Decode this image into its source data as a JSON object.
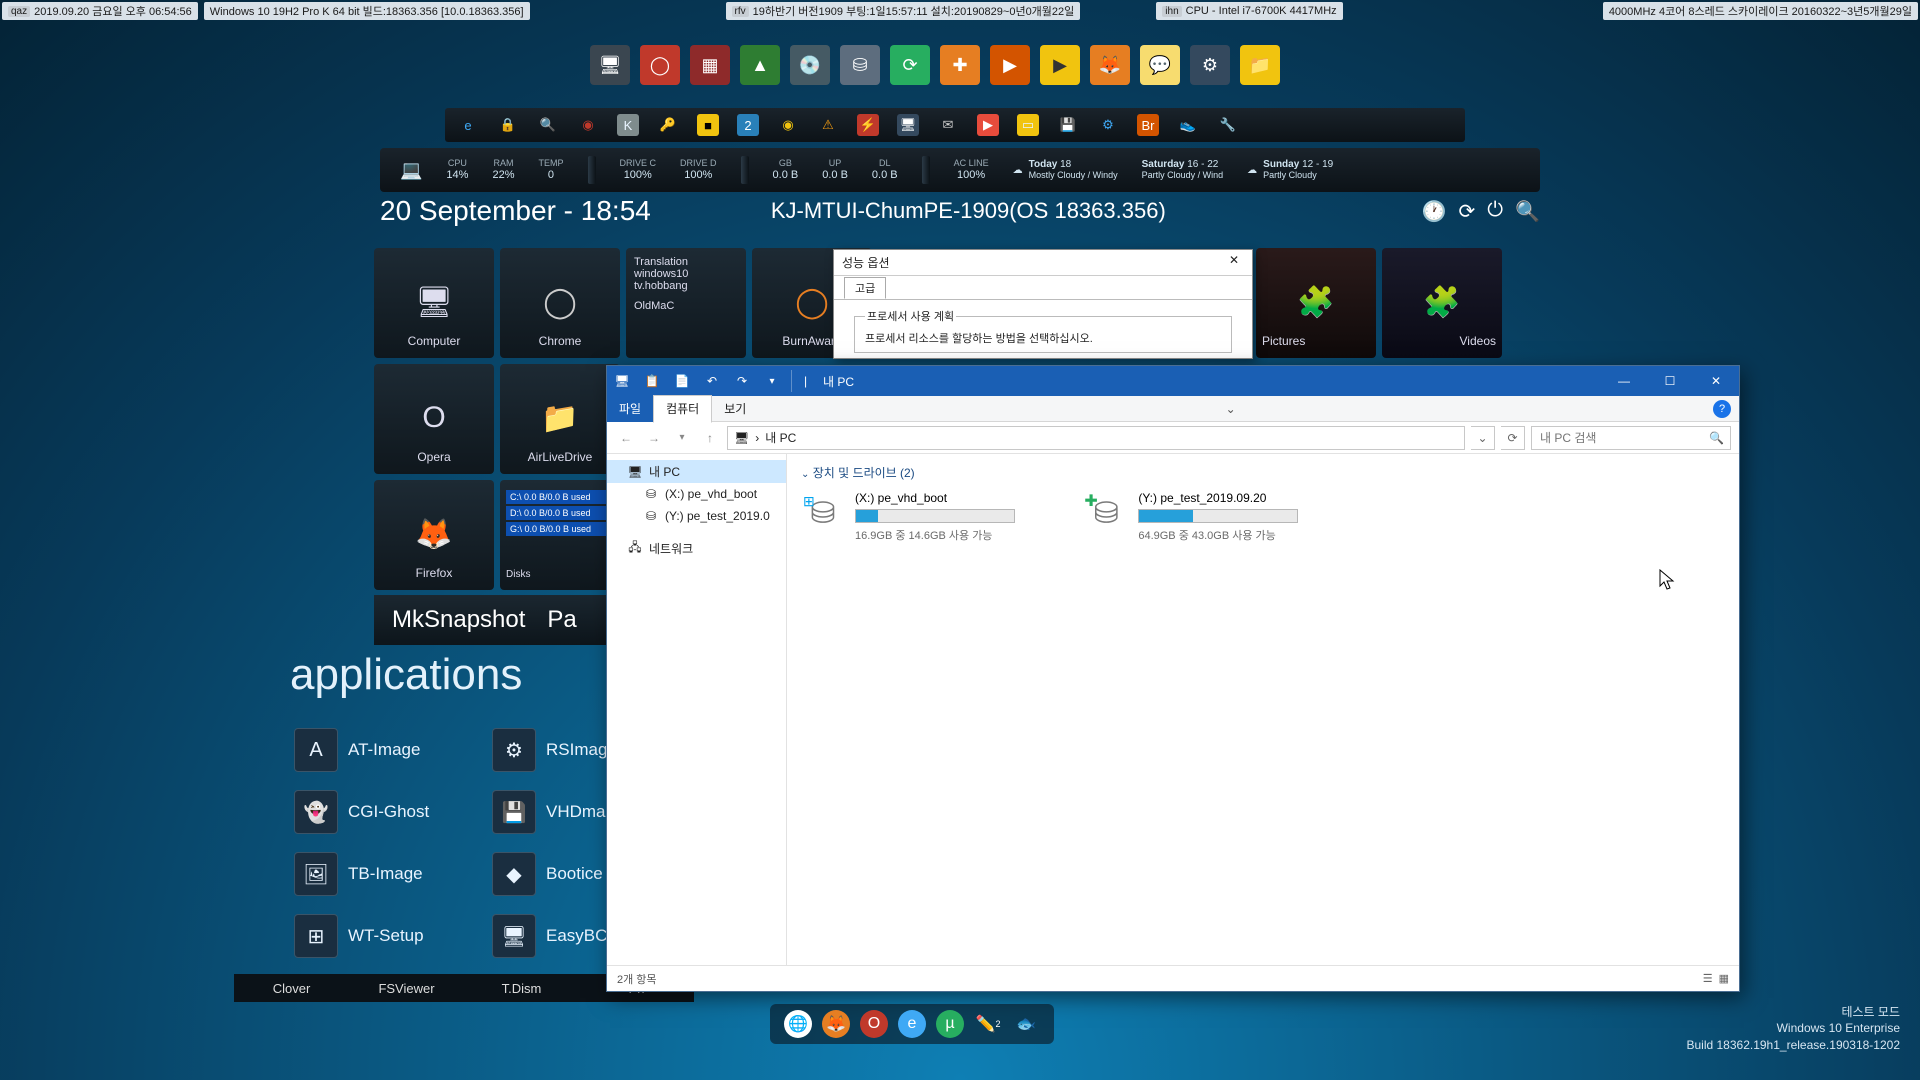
{
  "topInfo": [
    {
      "tag": "qaz",
      "text": "2019.09.20 금요일 오후 06:54:56"
    },
    {
      "tag": "",
      "text": "Windows 10 19H2 Pro K 64 bit 빌드:18363.356 [10.0.18363.356]"
    },
    {
      "tag": "rfv",
      "text": "19하반기 버전1909 부팅:1일15:57:11 설치:20190829~0년0개월22일"
    },
    {
      "tag": "ihn",
      "text": "CPU - Intel i7-6700K 4417MHz"
    },
    {
      "tag": "",
      "text": "4000MHz 4코어 8스레드 스카이레이크 20160322~3년5개월29일"
    }
  ],
  "stats": {
    "cpu": {
      "lab": "CPU",
      "val": "14%"
    },
    "ram": {
      "lab": "RAM",
      "val": "22%"
    },
    "temp": {
      "lab": "TEMP",
      "val": "0"
    },
    "drivec": {
      "lab": "DRIVE C",
      "val": "100%"
    },
    "drived": {
      "lab": "DRIVE D",
      "val": "100%"
    },
    "gb": {
      "lab": "GB",
      "val": "0.0 B"
    },
    "up": {
      "lab": "UP",
      "val": "0.0 B"
    },
    "dl": {
      "lab": "DL",
      "val": "0.0 B"
    },
    "acline": {
      "lab": "AC LINE",
      "val": "100%"
    },
    "wx1": {
      "day": "Today",
      "t": "18",
      "d": "Mostly Cloudy / Windy"
    },
    "wx2": {
      "day": "Saturday",
      "t": "16 - 22",
      "d": "Partly Cloudy / Wind"
    },
    "wx3": {
      "day": "Sunday",
      "t": "12 - 19",
      "d": "Partly Cloudy"
    }
  },
  "dateRow": {
    "date": "20 September - 18:54",
    "pc": "KJ-MTUI-ChumPE-1909(OS 18363.356)"
  },
  "tiles": {
    "computer": "Computer",
    "chrome": "Chrome",
    "oldmac": "OldMaC",
    "burnaware": "BurnAware",
    "translation_l1": "Translation",
    "translation_l2": "windows10",
    "translation_l3": "tv.hobbang",
    "pictures": "Pictures",
    "videos": "Videos",
    "opera": "Opera",
    "airlive": "AirLiveDrive",
    "firefox": "Firefox",
    "disks": "Disks",
    "disk_c": "C:\\ 0.0 B/0.0 B used",
    "disk_d": "D:\\ 0.0 B/0.0 B used",
    "disk_g": "G:\\ 0.0 B/0.0 B used"
  },
  "clockRow": {
    "a": "MkSnapshot",
    "b": "Pa"
  },
  "appsHeader": "applications",
  "apps": [
    "AT-Image",
    "RSImag",
    "CGI-Ghost",
    "VHDma",
    "TB-Image",
    "Bootice",
    "WT-Setup",
    "EasyBC"
  ],
  "bottom": [
    "Clover",
    "FSViewer",
    "T.Dism",
    "Ph"
  ],
  "perf": {
    "title": "성능 옵션",
    "tab": "고급",
    "grp": "프로세서 사용 계획",
    "line": "프로세서 리소스를 할당하는 방법을 선택하십시오."
  },
  "explorer": {
    "qatTitle": "내 PC",
    "menu": {
      "file": "파일",
      "computer": "컴퓨터",
      "view": "보기"
    },
    "addr": {
      "root": "내 PC",
      "searchPlaceholder": "내 PC 검색"
    },
    "tree": {
      "pc": "내 PC",
      "x": "(X:) pe_vhd_boot",
      "y": "(Y:) pe_test_2019.0",
      "net": "네트워크"
    },
    "group": "장치 및 드라이브 (2)",
    "drives": [
      {
        "name": "(X:) pe_vhd_boot",
        "cap": "16.9GB 중 14.6GB 사용 가능",
        "fill": 14
      },
      {
        "name": "(Y:) pe_test_2019.09.20",
        "cap": "64.9GB 중 43.0GB 사용 가능",
        "fill": 34
      }
    ],
    "status": "2개 항목"
  },
  "watermark": {
    "l1": "테스트 모드",
    "l2": "Windows 10 Enterprise",
    "l3": "Build 18362.19h1_release.190318-1202"
  }
}
